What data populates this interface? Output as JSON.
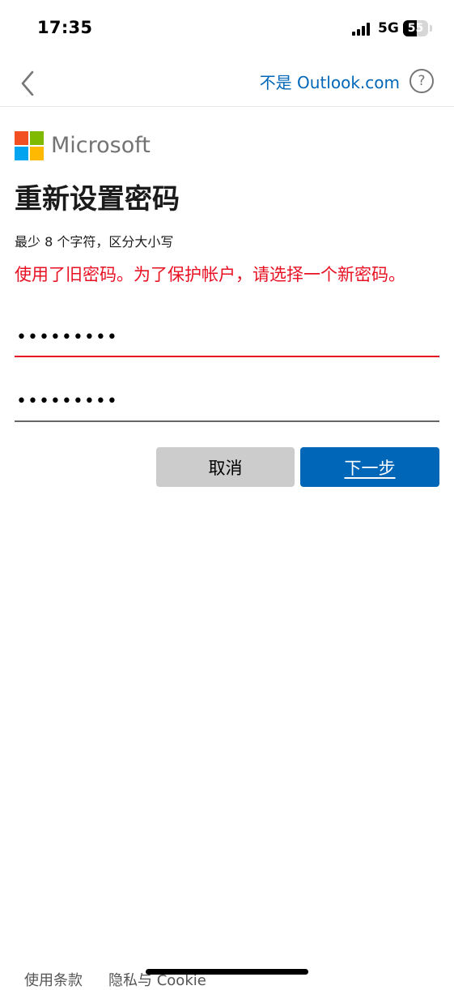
{
  "status_bar": {
    "time": "17:35",
    "network": "5G",
    "battery_level": "55",
    "signal_icon": "signal-bars-icon"
  },
  "nav": {
    "back_icon": "chevron-left-icon",
    "switch_account_link": "不是 Outlook.com",
    "help_label": "?",
    "help_icon": "question-circle-icon"
  },
  "logo": {
    "text": "Microsoft",
    "colors": [
      "#f25022",
      "#7fba00",
      "#00a4ef",
      "#ffb900"
    ]
  },
  "form": {
    "title": "重新设置密码",
    "hint": "最少 8 个字符，区分大小写",
    "error": "使用了旧密码。为了保护帐户，请选择一个新密码。",
    "new_password_value": "•••••••••",
    "confirm_password_value": "•••••••••",
    "cancel_label": "取消",
    "next_label": "下一步"
  },
  "footer": {
    "terms_label": "使用条款",
    "privacy_label": "隐私与 Cookie"
  },
  "colors": {
    "accent": "#0067b8",
    "error": "#e81123",
    "cancel_bg": "#cccccc"
  }
}
